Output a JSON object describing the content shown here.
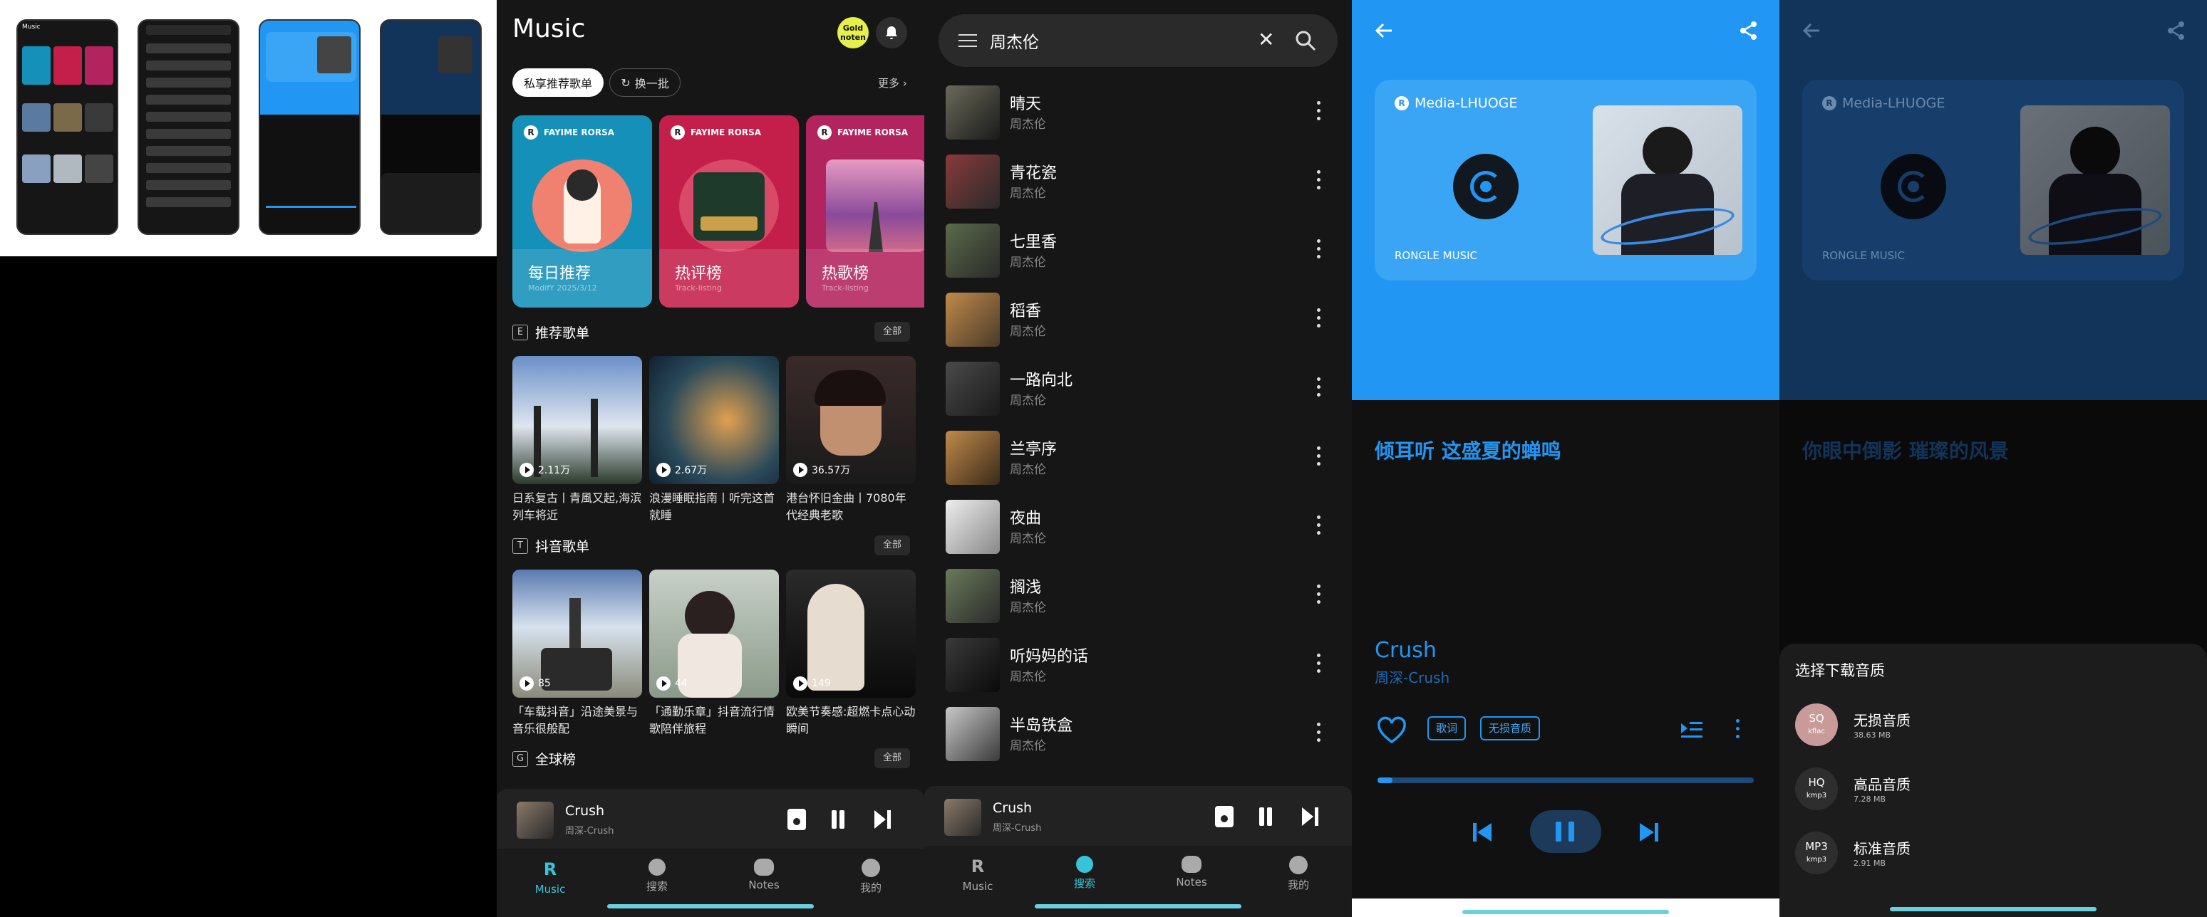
{
  "thumbs": {
    "t1_title": "Music"
  },
  "home": {
    "title": "Music",
    "gold_badge": "Gold noten",
    "pill_active": "私享推荐歌单",
    "pill_refresh": "换一批",
    "more": "更多 ›",
    "featured": [
      {
        "brand": "FAYIME RORSA",
        "name": "每日推荐",
        "sub": "ModifY  2025/3/12",
        "color": "#1590b8"
      },
      {
        "brand": "FAYIME RORSA",
        "name": "热评榜",
        "sub": "Track-listing",
        "color": "#c41f4a"
      },
      {
        "brand": "FAYIME RORSA",
        "name": "热歌榜",
        "sub": "Track-listing",
        "color": "#b3245e"
      }
    ],
    "sections": [
      {
        "badge": "E",
        "title": "推荐歌单",
        "all": "全部"
      },
      {
        "badge": "T",
        "title": "抖音歌单",
        "all": "全部"
      },
      {
        "badge": "G",
        "title": "全球榜",
        "all": "全部"
      }
    ],
    "playlists1": [
      {
        "count": "2.11万",
        "title": "日系复古丨青風又起,海滨列车将近"
      },
      {
        "count": "2.67万",
        "title": "浪漫睡眠指南丨听完这首就睡"
      },
      {
        "count": "36.57万",
        "title": "港台怀旧金曲丨7080年代经典老歌"
      }
    ],
    "playlists2": [
      {
        "count": "85",
        "title": "「车载抖音」沿途美景与音乐很般配"
      },
      {
        "count": "44",
        "title": "「通勤乐章」抖音流行情歌陪伴旅程"
      },
      {
        "count": "149",
        "title": "欧美节奏感:超燃卡点心动瞬间"
      }
    ]
  },
  "player_mini": {
    "title": "Crush",
    "artist": "周深-Crush"
  },
  "nav": [
    {
      "label": "Music"
    },
    {
      "label": "搜索"
    },
    {
      "label": "Notes"
    },
    {
      "label": "我的"
    }
  ],
  "search": {
    "query": "周杰伦",
    "results": [
      {
        "name": "晴天",
        "artist": "周杰伦"
      },
      {
        "name": "青花瓷",
        "artist": "周杰伦"
      },
      {
        "name": "七里香",
        "artist": "周杰伦"
      },
      {
        "name": "稻香",
        "artist": "周杰伦"
      },
      {
        "name": "一路向北",
        "artist": "周杰伦"
      },
      {
        "name": "兰亭序",
        "artist": "周杰伦"
      },
      {
        "name": "夜曲",
        "artist": "周杰伦"
      },
      {
        "name": "搁浅",
        "artist": "周杰伦"
      },
      {
        "name": "听妈妈的话",
        "artist": "周杰伦"
      },
      {
        "name": "半岛铁盒",
        "artist": "周杰伦"
      }
    ]
  },
  "now_playing": {
    "brand": "Media-LHUOGE",
    "card_caption": "RONGLE  MUSIC",
    "lyric": "倾耳听 这盛夏的蝉鸣",
    "title": "Crush",
    "artist": "周深-Crush",
    "tag_lyrics": "歌词",
    "tag_quality": "无损音质",
    "progress": 0.04,
    "accent": "#2196f3"
  },
  "download": {
    "lyric": "你眼中倒影 璀璨的风景",
    "sheet_title": "选择下载音质",
    "options": [
      {
        "badge": "SQ",
        "fmt": "kflac",
        "name": "无损音质",
        "size": "38.63  MB"
      },
      {
        "badge": "HQ",
        "fmt": "kmp3",
        "name": "高品音质",
        "size": "7.28  MB"
      },
      {
        "badge": "MP3",
        "fmt": "kmp3",
        "name": "标准音质",
        "size": "2.91  MB"
      }
    ]
  }
}
